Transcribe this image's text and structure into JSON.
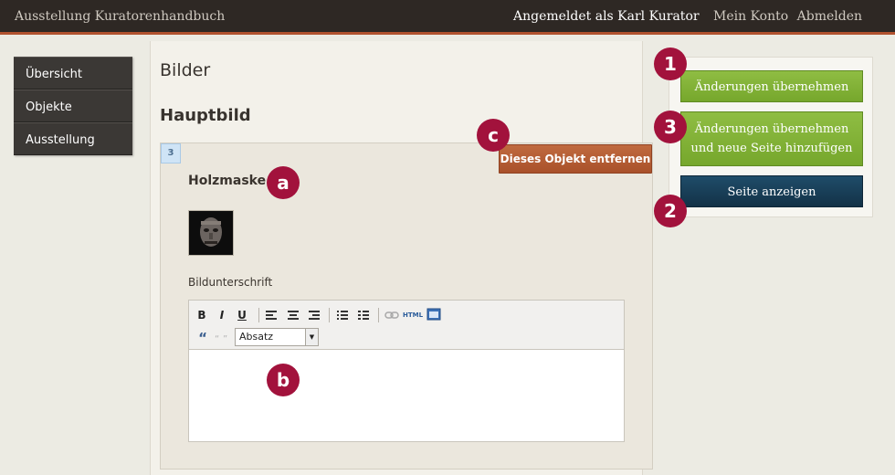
{
  "header": {
    "app_title": "Ausstellung Kuratorenhandbuch",
    "logged_in_as": "Angemeldet als Karl Kurator",
    "my_account": "Mein Konto",
    "logout": "Abmelden"
  },
  "sidebar": {
    "items": [
      {
        "label": "Übersicht"
      },
      {
        "label": "Objekte"
      },
      {
        "label": "Ausstellung"
      }
    ]
  },
  "main": {
    "section_title": "Bilder",
    "subsection_title": "Hauptbild",
    "item": {
      "number": "3",
      "remove_label": "Dieses Objekt entfernen",
      "title": "Holzmaske",
      "caption_label": "Bildunterschrift"
    },
    "editor": {
      "bold": "B",
      "italic": "I",
      "underline": "U",
      "html": "HTML",
      "quote": "“",
      "format_select": "Absatz",
      "content": ""
    }
  },
  "actions": {
    "save": "Änderungen übernehmen",
    "save_and_new_line1": "Änderungen übernehmen",
    "save_and_new_line2": "und neue Seite hinzufügen",
    "view_page": "Seite anzeigen"
  },
  "markers": {
    "m1": "1",
    "m3": "3",
    "m2": "2",
    "ma": "a",
    "mb": "b",
    "mc": "c"
  },
  "colors": {
    "marker": "#a2123c",
    "accent_green": "#7fae33",
    "accent_blue": "#1b3f57",
    "remove_button": "#b35a31",
    "header_bar": "#2e2824"
  }
}
